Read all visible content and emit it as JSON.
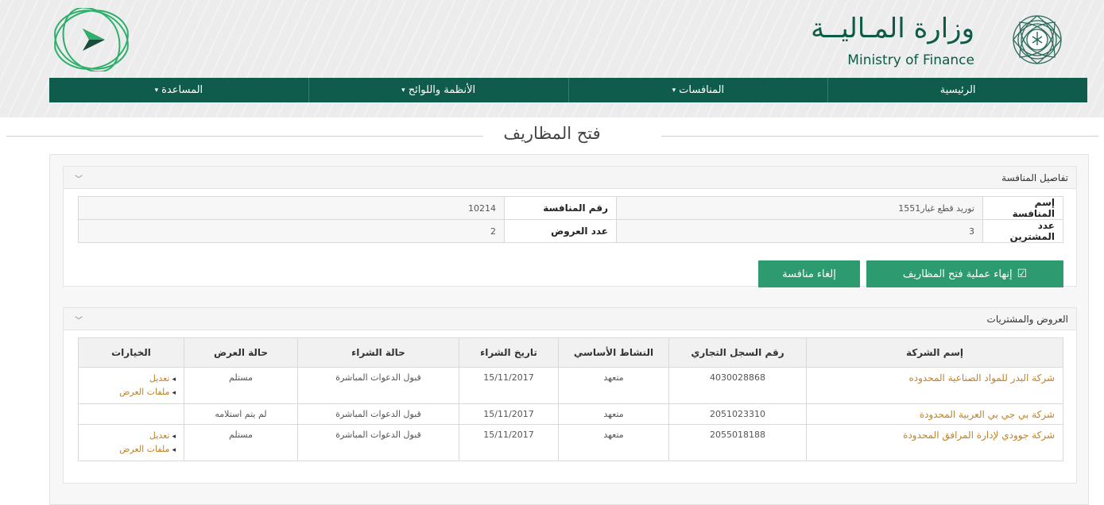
{
  "header": {
    "ministry_ar": "وزارة المـاليــة",
    "ministry_en": "Ministry of Finance"
  },
  "nav": {
    "items": [
      {
        "label": "الرئيسية",
        "has_caret": false
      },
      {
        "label": "المنافسات",
        "has_caret": true
      },
      {
        "label": "الأنظمة واللوائح",
        "has_caret": true
      },
      {
        "label": "المساعدة",
        "has_caret": true
      }
    ]
  },
  "page_title": "فتح المظاريف",
  "details": {
    "title": "تفاصيل المنافسة",
    "name_label": "إسم المنافسة",
    "name_value": "توريد قطع غيار1551",
    "number_label": "رقم المنافسة",
    "number_value": "10214",
    "buyers_label": "عدد المشترين",
    "buyers_value": "3",
    "offers_label": "عدد العروض",
    "offers_value": "2",
    "finish_button": "إنهاء عملية فتح المظاريف",
    "cancel_button": "إلغاء منافسة"
  },
  "offers": {
    "title": "العروض والمشتريات",
    "columns": [
      "إسم الشركة",
      "رقم السجل التجاري",
      "النشاط الأساسي",
      "تاريخ الشراء",
      "حالة الشراء",
      "حالة العرض",
      "الخيارات"
    ],
    "rows": [
      {
        "company": "شركة البدر للمواد الصناعية المحدوده",
        "cr": "4030028868",
        "activity": "متعهد",
        "date": "15/11/2017",
        "purchase_status": "قبول الدعوات المباشرة",
        "offer_status": "مستلم",
        "options": [
          "تعديل",
          "ملفات العرض"
        ]
      },
      {
        "company": "شركة بي جي بي العربية المحدودة",
        "cr": "2051023310",
        "activity": "متعهد",
        "date": "15/11/2017",
        "purchase_status": "قبول الدعوات المباشرة",
        "offer_status": "لم يتم استلامه",
        "options": []
      },
      {
        "company": "شركة جوودي لإدارة المرافق المحدودة",
        "cr": "2055018188",
        "activity": "متعهد",
        "date": "15/11/2017",
        "purchase_status": "قبول الدعوات المباشرة",
        "offer_status": "مستلم",
        "options": [
          "تعديل",
          "ملفات العرض"
        ]
      }
    ]
  },
  "colors": {
    "nav_bg": "#0f5c4c",
    "button_bg": "#2e9a70",
    "link": "#c0832a",
    "brand_green": "#0d5a47"
  }
}
